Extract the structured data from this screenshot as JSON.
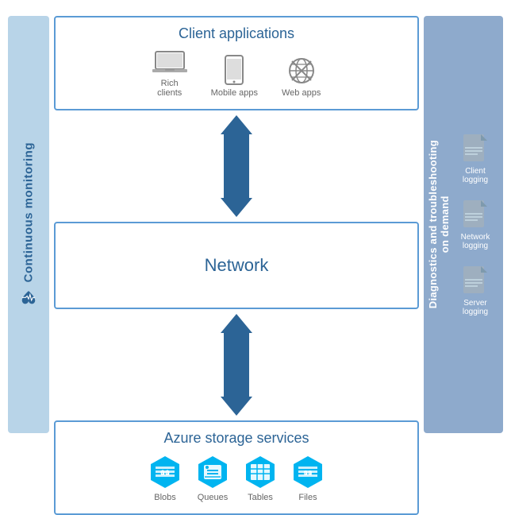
{
  "leftSidebar": {
    "label": "Continuous monitoring"
  },
  "clientApps": {
    "title": "Client applications",
    "icons": [
      {
        "name": "Rich clients",
        "type": "laptop"
      },
      {
        "name": "Mobile apps",
        "type": "mobile"
      },
      {
        "name": "Web apps",
        "type": "globe"
      }
    ]
  },
  "network": {
    "title": "Network"
  },
  "azureStorage": {
    "title": "Azure storage services",
    "icons": [
      {
        "name": "Blobs",
        "type": "blobs"
      },
      {
        "name": "Queues",
        "type": "queues"
      },
      {
        "name": "Tables",
        "type": "tables"
      },
      {
        "name": "Files",
        "type": "files"
      }
    ]
  },
  "rightSidebar": {
    "line1": "Diagnostics and troubleshooting",
    "line2": "on demand",
    "logging": [
      {
        "name": "Client\nlogging"
      },
      {
        "name": "Network\nlogging"
      },
      {
        "name": "Server\nlogging"
      }
    ]
  }
}
